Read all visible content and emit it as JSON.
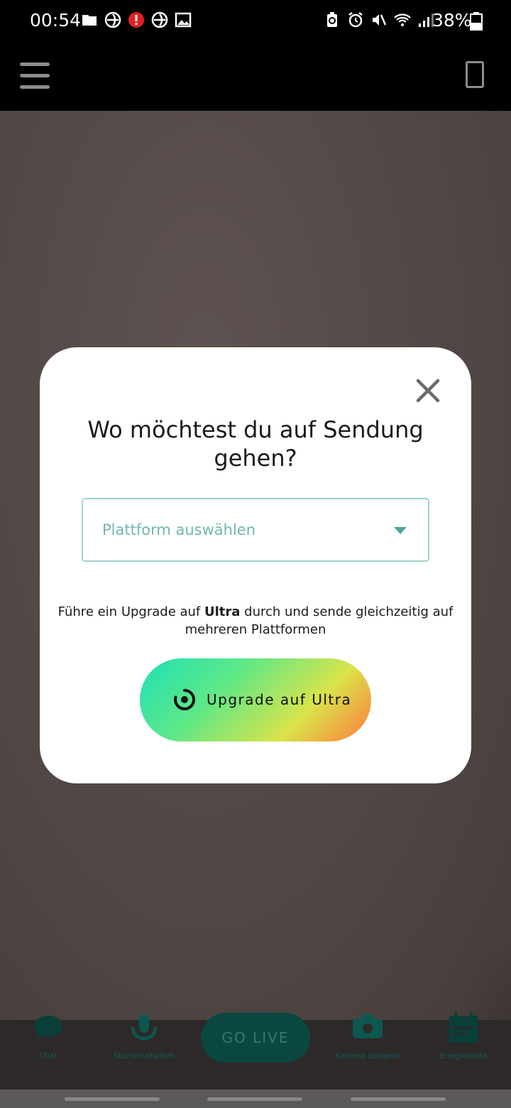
{
  "status_bar": {
    "time": "00:54",
    "battery_percent": "38%",
    "left_icons": [
      "folder-icon",
      "app-icon",
      "alert-icon",
      "app-icon",
      "image-icon"
    ],
    "right_icons": [
      "battery-saver-icon",
      "alarm-icon",
      "mute-icon",
      "wifi-icon",
      "signal-icon",
      "battery-icon"
    ]
  },
  "app_bar": {
    "menu_icon": "hamburger-icon",
    "device_icon": "phone-orientation-icon"
  },
  "modal": {
    "title": "Wo möchtest du auf Sendung gehen?",
    "select_placeholder": "Plattform auswählen",
    "note_before": "Führe ein Upgrade auf ",
    "note_bold": "Ultra",
    "note_after": " durch und sende gleichzeitig auf mehreren Plattformen",
    "upgrade_button": "Upgrade auf Ultra",
    "colors": {
      "select_border": "#9fd3cf",
      "placeholder": "#6fb7b0"
    }
  },
  "toolbar": {
    "items": [
      {
        "label": "Chat",
        "icon": "chat-icon"
      },
      {
        "label": "Stummschalten",
        "icon": "microphone-icon"
      },
      {
        "label": "Kamera spiegeln",
        "icon": "camera-flip-icon"
      },
      {
        "label": "Ereignisliste",
        "icon": "event-list-icon"
      }
    ],
    "go_live": "GO LIVE"
  }
}
